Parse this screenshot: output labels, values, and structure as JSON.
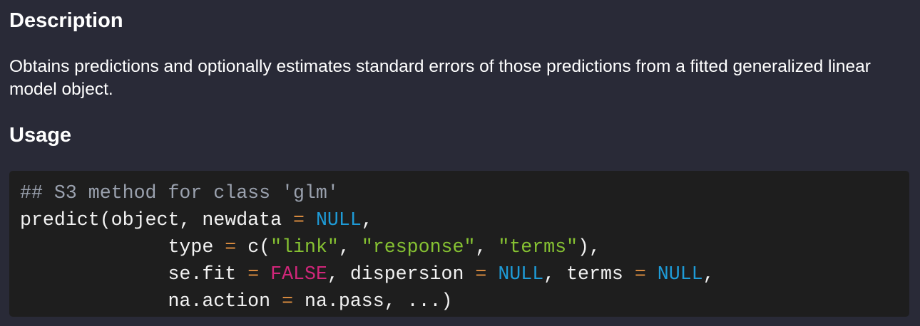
{
  "description": {
    "heading": "Description",
    "text": "Obtains predictions and optionally estimates standard errors of those predictions from a fitted generalized linear model object."
  },
  "usage": {
    "heading": "Usage",
    "code": {
      "line1": {
        "comment": "## S3 method for class 'glm'"
      },
      "line2": {
        "a": "predict(object, newdata ",
        "op1": "=",
        "b": " ",
        "null1": "NULL",
        "c": ","
      },
      "line3": {
        "indent": "             ",
        "a": "type ",
        "op1": "=",
        "b": " c(",
        "s1": "\"link\"",
        "c": ", ",
        "s2": "\"response\"",
        "d": ", ",
        "s3": "\"terms\"",
        "e": "),"
      },
      "line4": {
        "indent": "             ",
        "a": "se.fit ",
        "op1": "=",
        "b": " ",
        "false1": "FALSE",
        "c": ", dispersion ",
        "op2": "=",
        "d": " ",
        "null1": "NULL",
        "e": ", terms ",
        "op3": "=",
        "f": " ",
        "null2": "NULL",
        "g": ","
      },
      "line5": {
        "indent": "             ",
        "a": "na.action ",
        "op1": "=",
        "b": " na.pass, ...)"
      }
    }
  },
  "colors": {
    "background": "#292a37",
    "code_background": "#1e1e1e",
    "comment": "#9aa1ae",
    "operator": "#d6893e",
    "null_keyword": "#1e9bd7",
    "string": "#86c232",
    "false_keyword": "#d1267a"
  }
}
